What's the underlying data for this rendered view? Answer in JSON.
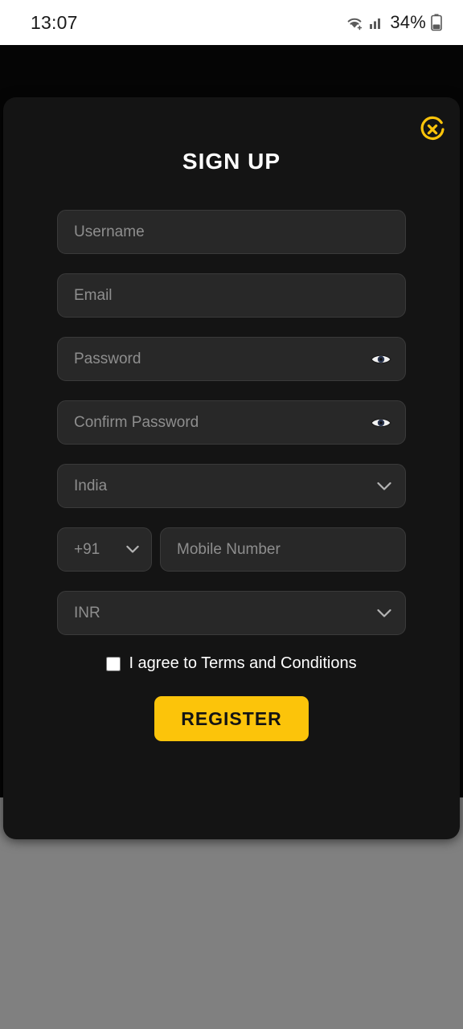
{
  "status_bar": {
    "time": "13:07",
    "battery_percent": "34%",
    "icons": [
      "wifi-icon",
      "cellular-signal-icon",
      "battery-icon"
    ]
  },
  "modal": {
    "title": "SIGN UP",
    "close_label": "×",
    "accent_color": "#fcc40a",
    "background_color": "#141414",
    "fields": {
      "username": {
        "placeholder": "Username",
        "value": ""
      },
      "email": {
        "placeholder": "Email",
        "value": ""
      },
      "password": {
        "placeholder": "Password",
        "value": ""
      },
      "confirm_password": {
        "placeholder": "Confirm Password",
        "value": ""
      },
      "country": {
        "selected": "India",
        "options": [
          "India"
        ]
      },
      "phone_code": {
        "selected": "+91",
        "options": [
          "+91"
        ]
      },
      "mobile_number": {
        "placeholder": "Mobile Number",
        "value": ""
      },
      "currency": {
        "selected": "INR",
        "options": [
          "INR"
        ]
      }
    },
    "terms": {
      "label": "I agree to Terms and Conditions",
      "checked": false
    },
    "register_label": "REGISTER"
  }
}
